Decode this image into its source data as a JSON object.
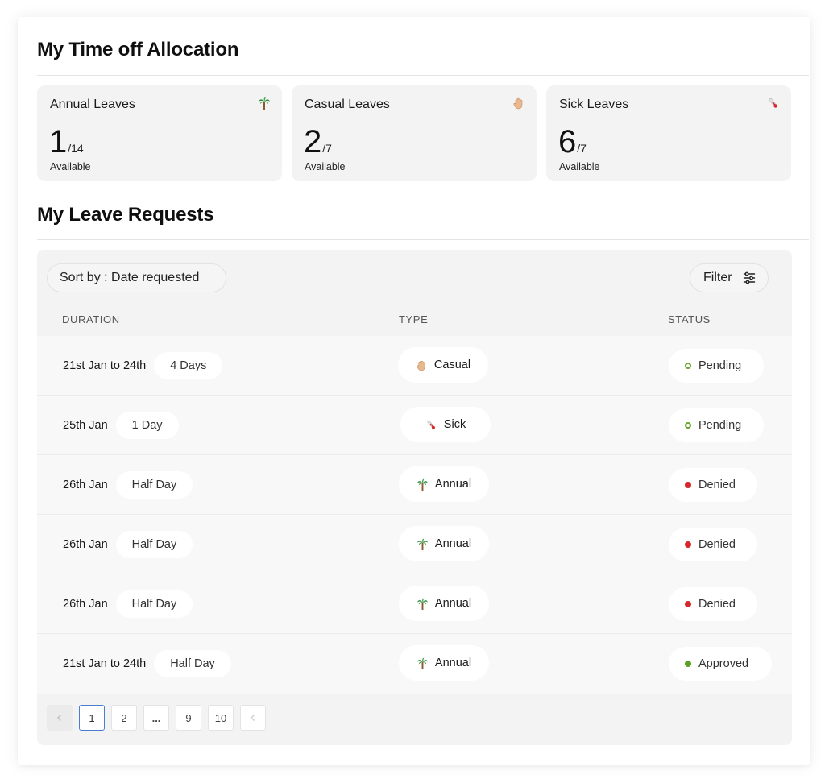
{
  "allocation": {
    "title": "My Time off Allocation",
    "cards": [
      {
        "name": "Annual Leaves",
        "used": "1",
        "total": "/14",
        "sub": "Available",
        "icon": "palm-tree-icon"
      },
      {
        "name": "Casual Leaves",
        "used": "2",
        "total": "/7",
        "sub": "Available",
        "icon": "waving-hand-icon"
      },
      {
        "name": "Sick Leaves",
        "used": "6",
        "total": "/7",
        "sub": "Available",
        "icon": "thermometer-icon"
      }
    ]
  },
  "requests": {
    "title": "My Leave Requests",
    "sort_label": "Sort by : Date requested",
    "filter_label": "Filter",
    "columns": {
      "duration": "DURATION",
      "type": "TYPE",
      "status": "STATUS"
    },
    "rows": [
      {
        "date": "21st Jan to 24th",
        "duration": "4 Days",
        "type": "Casual",
        "type_icon": "waving-hand-icon",
        "status": "Pending"
      },
      {
        "date": "25th Jan",
        "duration": "1 Day",
        "type": "Sick",
        "type_icon": "thermometer-icon",
        "status": "Pending"
      },
      {
        "date": "26th Jan",
        "duration": "Half Day",
        "type": "Annual",
        "type_icon": "palm-tree-icon",
        "status": "Denied"
      },
      {
        "date": "26th Jan",
        "duration": "Half Day",
        "type": "Annual",
        "type_icon": "palm-tree-icon",
        "status": "Denied"
      },
      {
        "date": "26th Jan",
        "duration": "Half Day",
        "type": "Annual",
        "type_icon": "palm-tree-icon",
        "status": "Denied"
      },
      {
        "date": "21st Jan to 24th",
        "duration": "Half Day",
        "type": "Annual",
        "type_icon": "palm-tree-icon",
        "status": "Approved"
      }
    ],
    "status_colors": {
      "Pending": "#6aa22e",
      "Denied": "#d8262c",
      "Approved": "#5aa023"
    },
    "pagination": {
      "pages": [
        "1",
        "2",
        "...",
        "9",
        "10"
      ],
      "current": "1"
    }
  }
}
